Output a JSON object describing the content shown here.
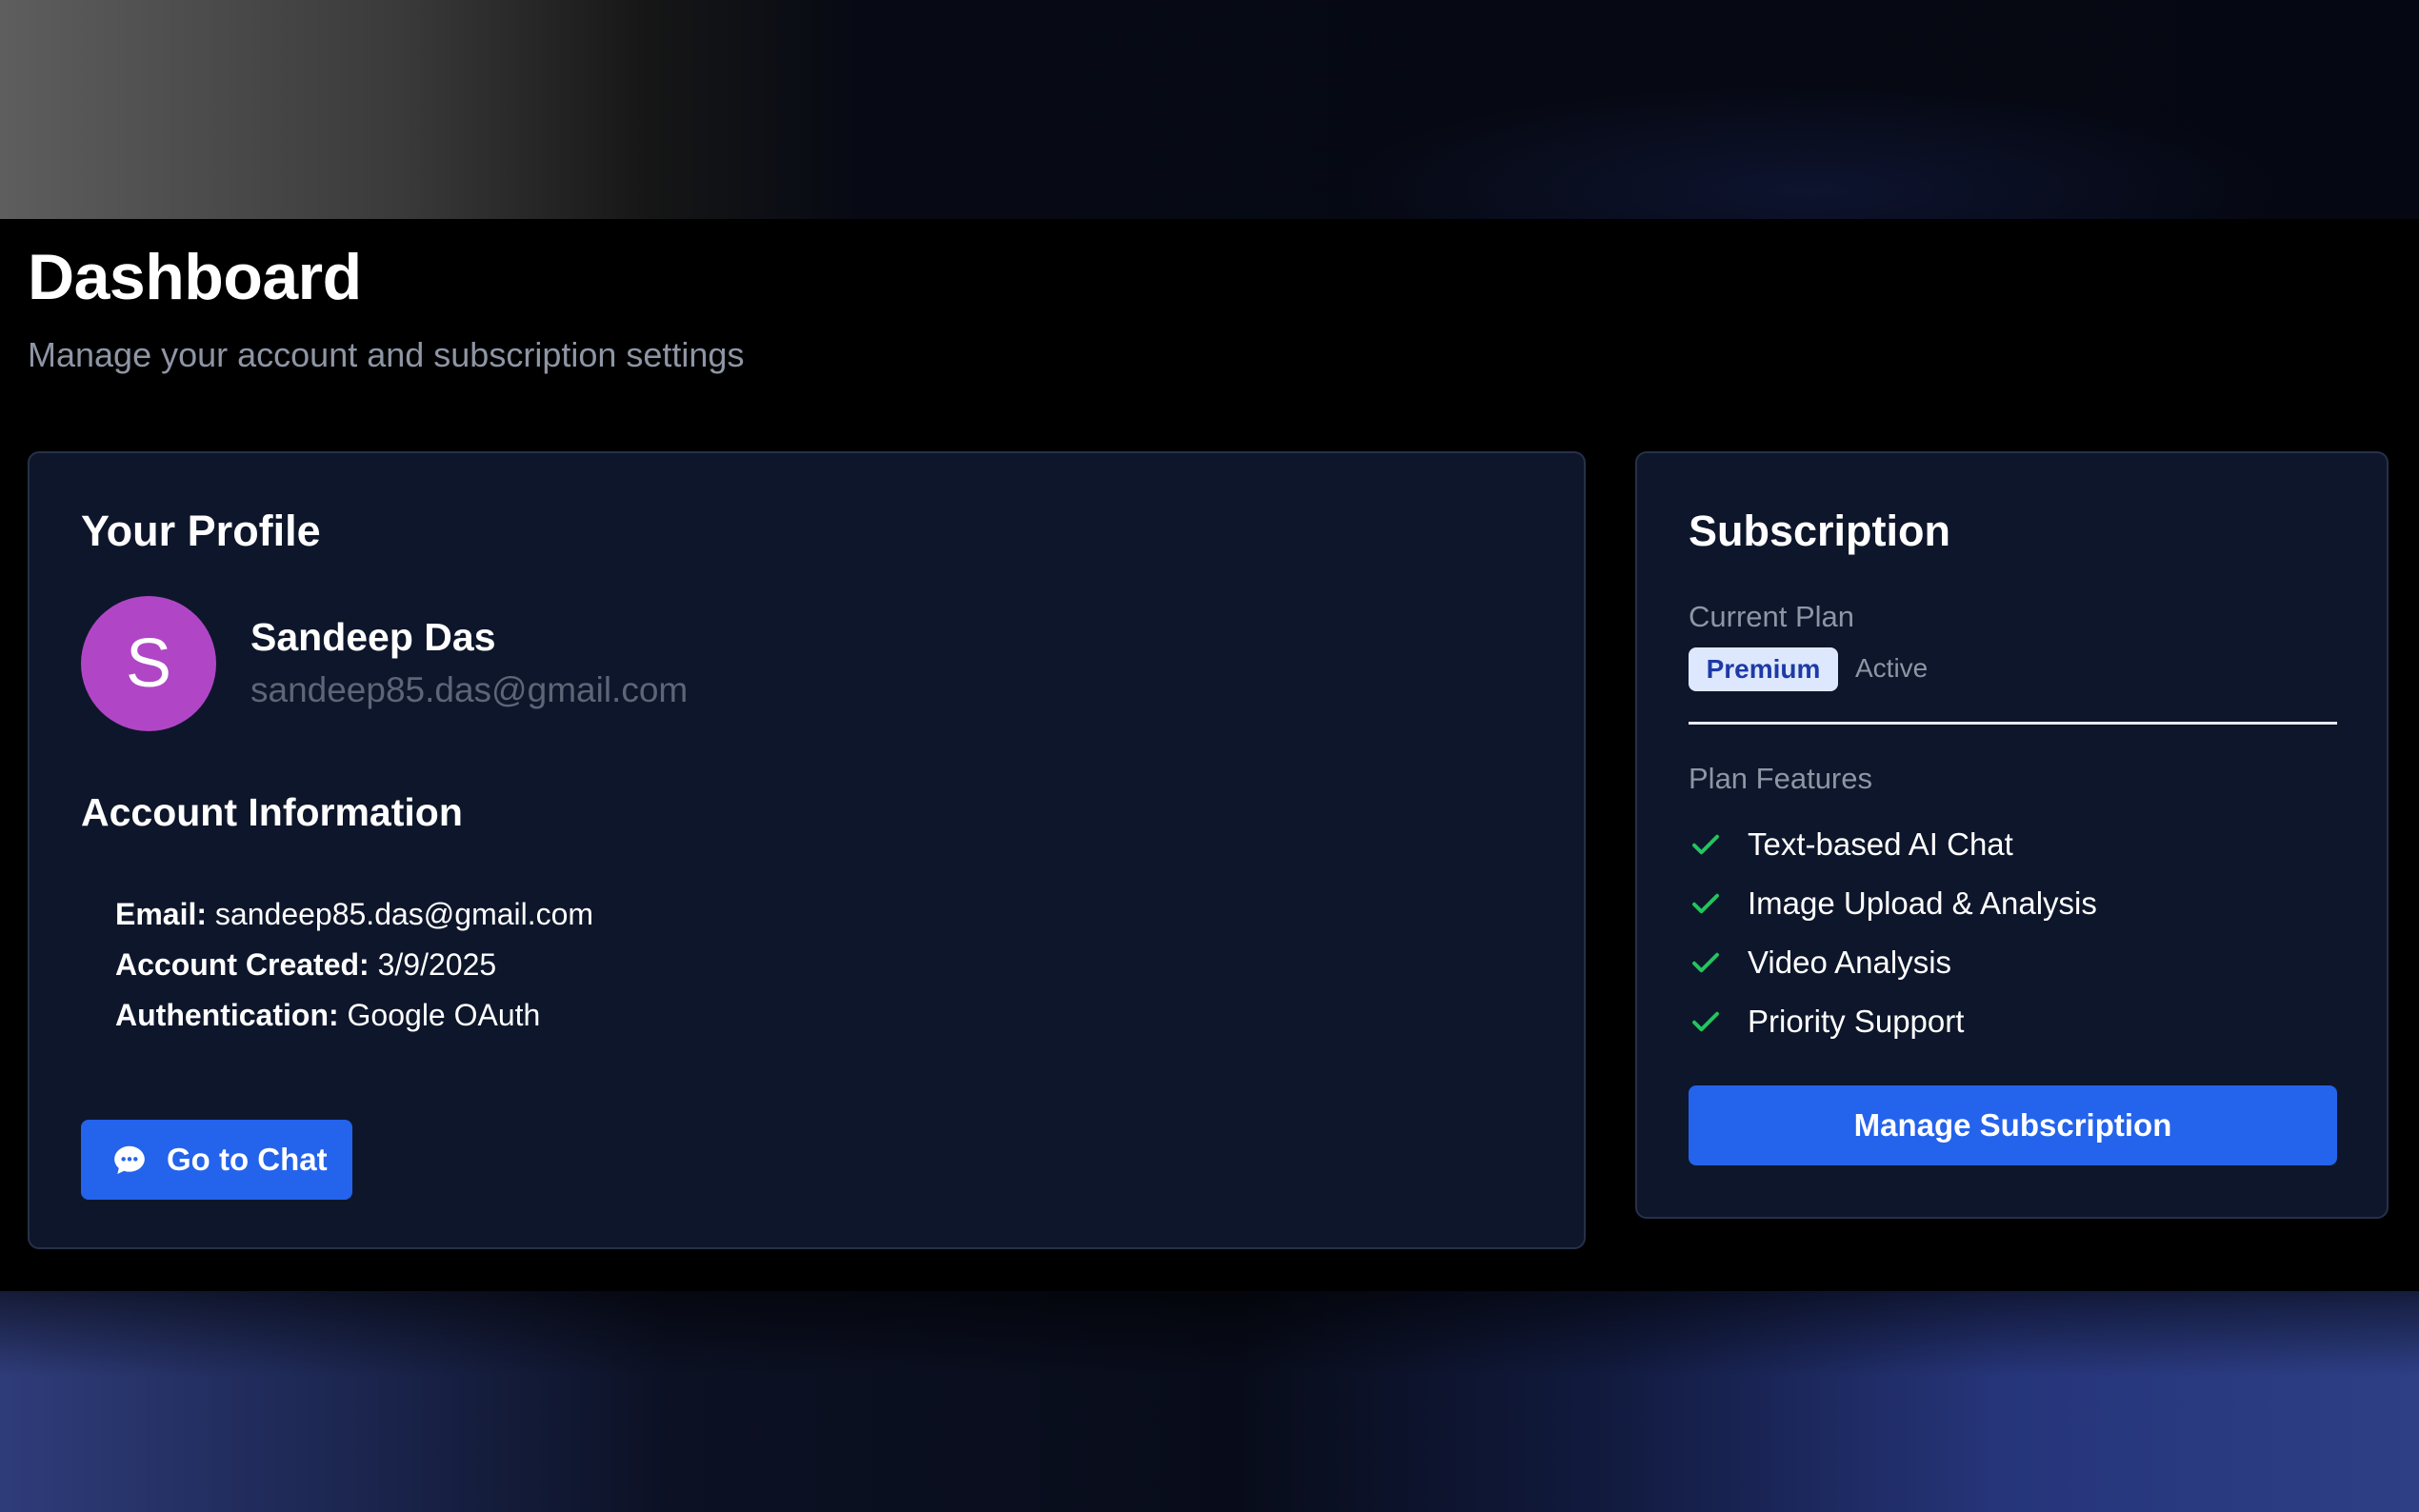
{
  "header": {
    "title": "Dashboard",
    "subtitle": "Manage your account and subscription settings"
  },
  "profile": {
    "card_title": "Your Profile",
    "avatar_letter": "S",
    "name": "Sandeep Das",
    "email": "sandeep85.das@gmail.com",
    "account_info_title": "Account Information",
    "info": [
      {
        "label": "Email:",
        "value": "sandeep85.das@gmail.com"
      },
      {
        "label": "Account Created:",
        "value": "3/9/2025"
      },
      {
        "label": "Authentication:",
        "value": "Google OAuth"
      }
    ],
    "chat_button_label": "Go to Chat",
    "chat_button_icon": "chat-bubble-icon"
  },
  "subscription": {
    "card_title": "Subscription",
    "current_plan_label": "Current Plan",
    "plan_badge": "Premium",
    "plan_status": "Active",
    "features_label": "Plan Features",
    "features": [
      "Text-based AI Chat",
      "Image Upload & Analysis",
      "Video Analysis",
      "Priority Support"
    ],
    "feature_icon": "check-icon",
    "manage_button_label": "Manage Subscription"
  },
  "colors": {
    "accent": "#2463eb",
    "avatar": "#b046c6",
    "check": "#22c55e",
    "card_bg": "#0e162b",
    "badge_bg": "#dde8ff",
    "badge_text": "#1d3aa6"
  }
}
